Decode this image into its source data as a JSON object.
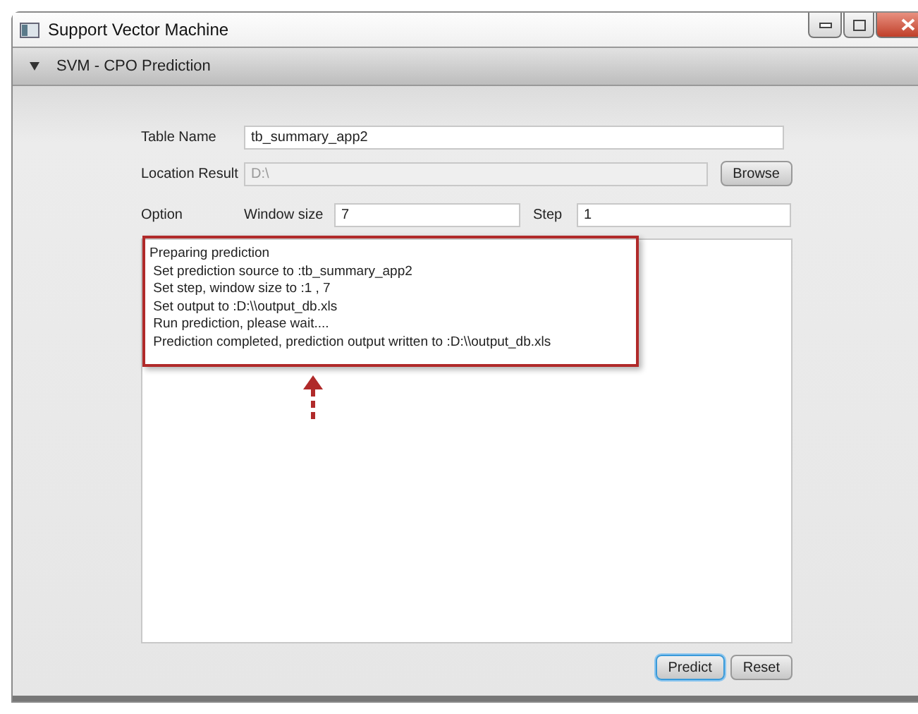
{
  "window": {
    "title": "Support Vector Machine"
  },
  "panel": {
    "title": "SVM - CPO Prediction",
    "expanded": true
  },
  "table_name": {
    "label": "Table Name",
    "value": "tb_summary_app2"
  },
  "location_result": {
    "label": "Location Result",
    "value": "D:\\",
    "disabled": true,
    "button": "Browse"
  },
  "option": {
    "label": "Option",
    "window_size_label": "Window size",
    "window_size": "7",
    "step_label": "Step",
    "step": "1"
  },
  "log_lines": [
    "Preparing prediction",
    " Set prediction source to :tb_summary_app2",
    " Set step, window size to :1 , 7",
    " Set output to :D:\\\\output_db.xls",
    " Run prediction, please wait....",
    " Prediction completed, prediction output written to :D:\\\\output_db.xls"
  ],
  "buttons": [
    {
      "label": "Predict",
      "focused": true
    },
    {
      "label": "Reset",
      "focused": false
    }
  ]
}
